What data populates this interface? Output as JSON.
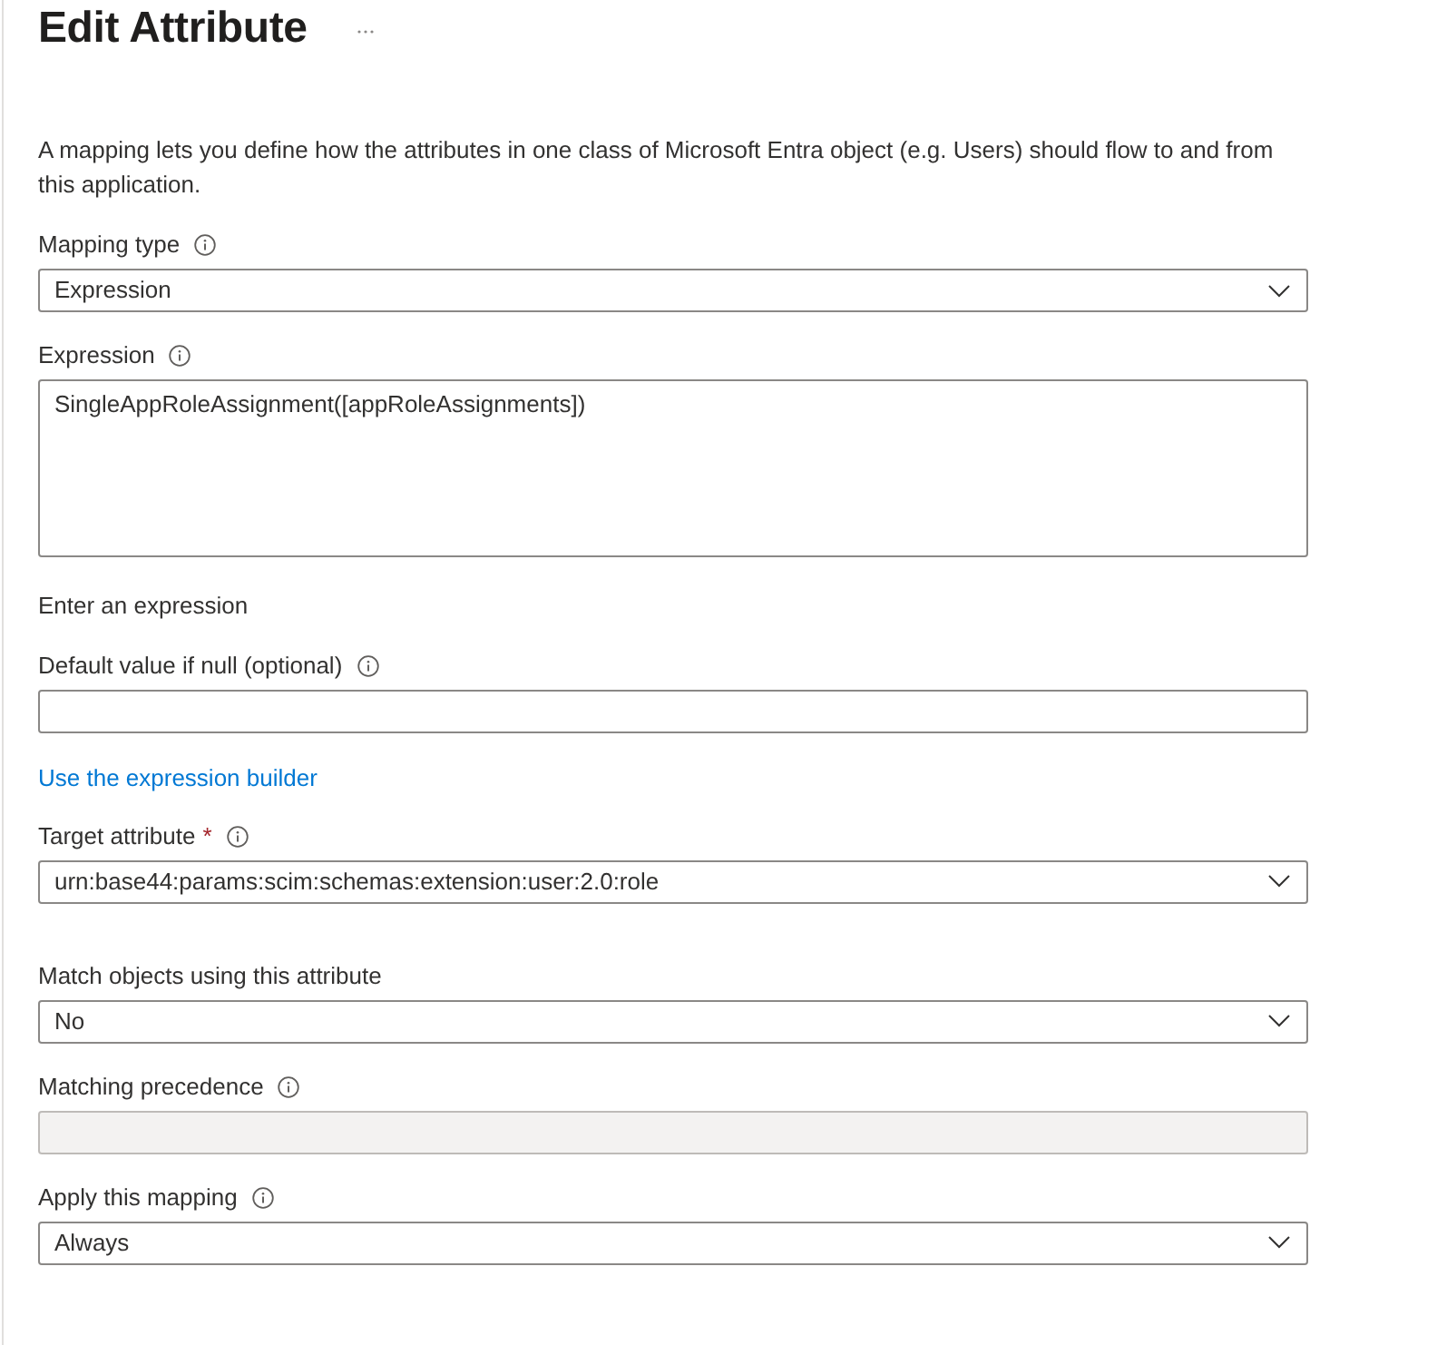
{
  "title": "Edit Attribute",
  "description": "A mapping lets you define how the attributes in one class of Microsoft Entra object (e.g. Users) should flow to and from this application.",
  "source_fields": [
    {
      "kind": "dropdown",
      "label": "Mapping type",
      "info": true,
      "disabled": false,
      "value": "Expression"
    },
    {
      "kind": "textarea",
      "label": "Expression",
      "info": true,
      "disabled": false,
      "value": "SingleAppRoleAssignment([appRoleAssignments])",
      "help": "Enter an expression"
    },
    {
      "kind": "text",
      "label": "Default value if null (optional)",
      "info": true,
      "disabled": false
    }
  ],
  "builder_link": "Use the expression builder",
  "target_fields": [
    {
      "kind": "dropdown",
      "label": "Target attribute",
      "required_mark": "*",
      "info": true,
      "disabled": false,
      "value": "urn:base44:params:scim:schemas:extension:user:2.0:role"
    }
  ],
  "matching_fields": [
    {
      "kind": "dropdown",
      "label": "Match objects using this attribute",
      "info": false,
      "disabled": false,
      "value": "No"
    },
    {
      "kind": "text",
      "label": "Matching precedence",
      "info": true,
      "disabled": true
    },
    {
      "kind": "dropdown",
      "label": "Apply this mapping",
      "info": true,
      "disabled": false,
      "value": "Always"
    }
  ]
}
